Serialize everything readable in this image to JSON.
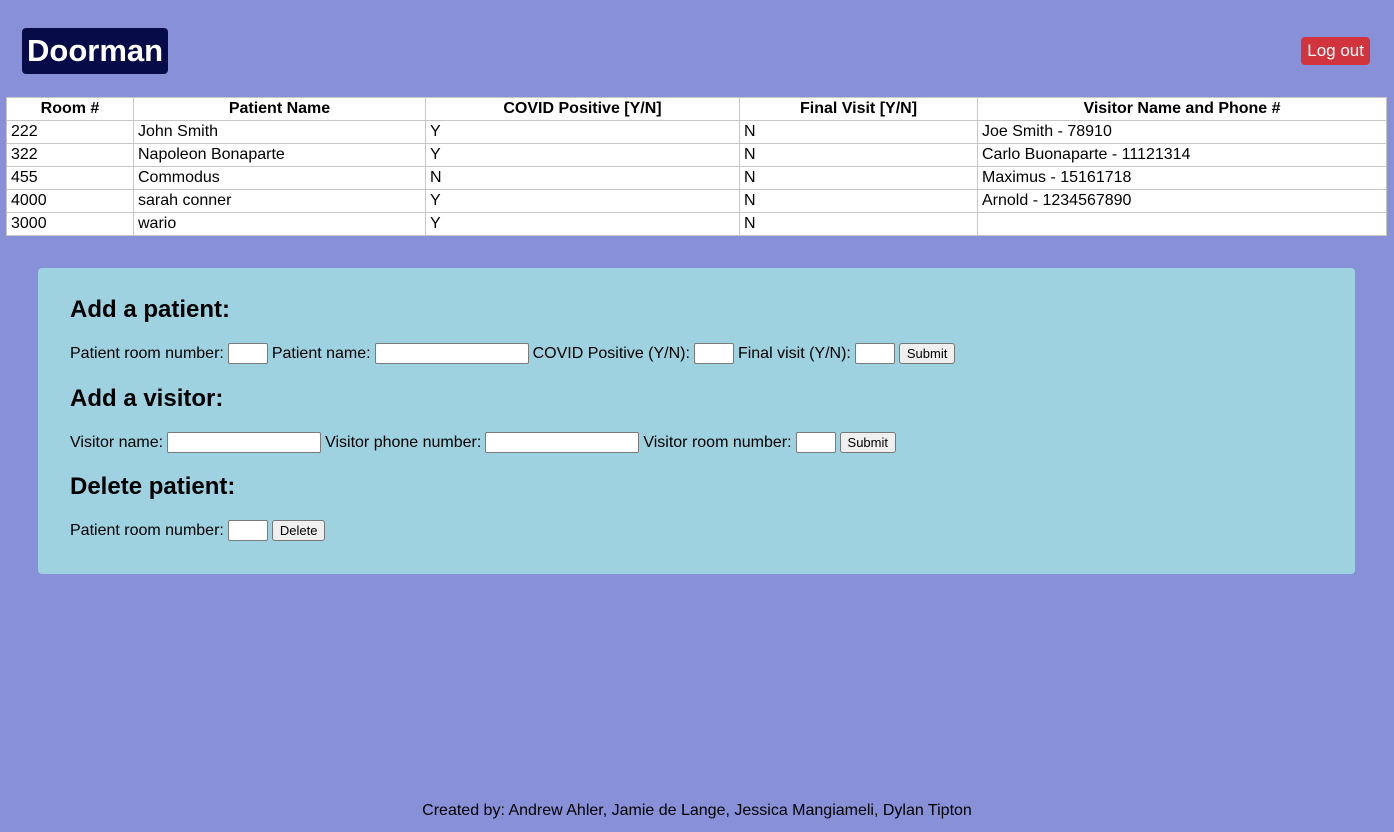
{
  "header": {
    "brand": "Doorman",
    "logout_label": "Log out"
  },
  "table": {
    "headers": [
      "Room #",
      "Patient Name",
      "COVID Positive [Y/N]",
      "Final Visit [Y/N]",
      "Visitor Name and Phone #"
    ],
    "rows": [
      [
        "222",
        "John Smith",
        "Y",
        "N",
        "Joe Smith - 78910"
      ],
      [
        "322",
        "Napoleon Bonaparte",
        "Y",
        "N",
        "Carlo Buonaparte - 11121314"
      ],
      [
        "455",
        "Commodus",
        "N",
        "N",
        "Maximus - 15161718"
      ],
      [
        "4000",
        "sarah conner",
        "Y",
        "N",
        "Arnold - 1234567890"
      ],
      [
        "3000",
        "wario",
        "Y",
        "N",
        ""
      ]
    ]
  },
  "add_patient": {
    "heading": "Add a patient:",
    "room_label": "Patient room number:",
    "room_value": "",
    "name_label": "Patient name:",
    "name_value": "",
    "covid_label": "COVID Positive (Y/N):",
    "covid_value": "",
    "final_label": "Final visit (Y/N):",
    "final_value": "",
    "submit_label": "Submit"
  },
  "add_visitor": {
    "heading": "Add a visitor:",
    "name_label": "Visitor name:",
    "name_value": "",
    "phone_label": "Visitor phone number:",
    "phone_value": "",
    "room_label": "Visitor room number:",
    "room_value": "",
    "submit_label": "Submit"
  },
  "delete_patient": {
    "heading": "Delete patient:",
    "room_label": "Patient room number:",
    "room_value": "",
    "delete_label": "Delete"
  },
  "footer": {
    "credits": "Created by: Andrew Ahler, Jamie de Lange, Jessica Mangiameli, Dylan Tipton"
  },
  "colors": {
    "background": "#8890d8",
    "brand_bg": "#070b48",
    "logout_bg": "#d1343c",
    "form_panel_bg": "#9fd2e0"
  }
}
